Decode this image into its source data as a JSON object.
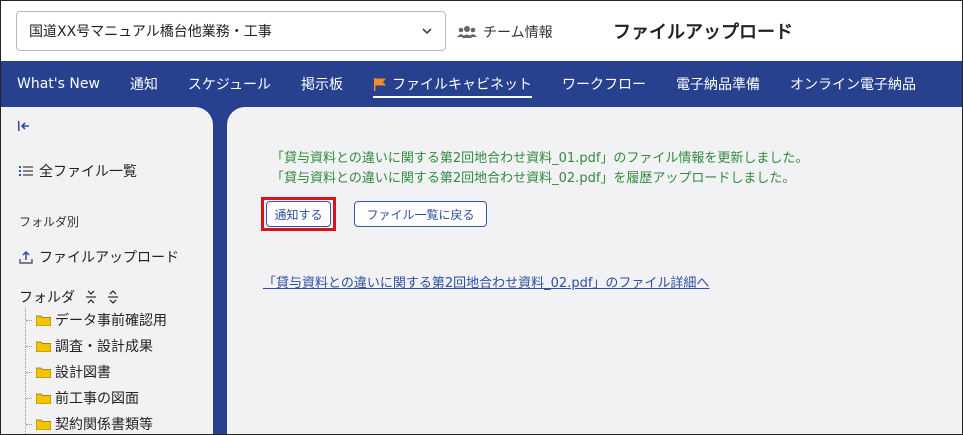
{
  "header": {
    "project_select_value": "国道XX号マニュアル橋台他業務・工事",
    "team_info_label": "チーム情報",
    "page_title": "ファイルアップロード"
  },
  "nav": {
    "items": [
      {
        "label": "What's New"
      },
      {
        "label": "通知"
      },
      {
        "label": "スケジュール"
      },
      {
        "label": "掲示板"
      },
      {
        "label": "ファイルキャビネット",
        "active": true
      },
      {
        "label": "ワークフロー"
      },
      {
        "label": "電子納品準備"
      },
      {
        "label": "オンライン電子納品"
      }
    ]
  },
  "sidebar": {
    "all_files_label": "全ファイル一覧",
    "by_folder_label": "フォルダ別",
    "upload_label": "ファイルアップロード",
    "folder_label": "フォルダ",
    "folders": [
      "データ事前確認用",
      "調査・設計成果",
      "設計図書",
      "前工事の図面",
      "契約関係書類等"
    ]
  },
  "main": {
    "messages": [
      "「貸与資料との違いに関する第2回地合わせ資料_01.pdf」のファイル情報を更新しました。",
      "「貸与資料との違いに関する第2回地合わせ資料_02.pdf」を履歴アップロードしました。"
    ],
    "notify_button": "通知する",
    "back_button": "ファイル一覧に戻る",
    "detail_link": "「貸与資料との違いに関する第2回地合わせ資料_02.pdf」のファイル詳細へ"
  },
  "colors": {
    "nav_bg": "#27418e",
    "success_text": "#2f8a3c",
    "link": "#2e4ea0",
    "highlight": "#d7141b",
    "flag": "#f08c2a",
    "folder": "#f5c400"
  }
}
